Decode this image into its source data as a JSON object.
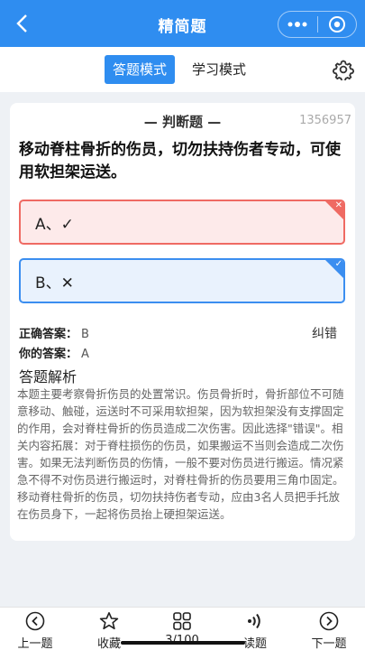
{
  "header": {
    "title": "精简题"
  },
  "modes": {
    "answer_mode": "答题模式",
    "study_mode": "学习模式"
  },
  "question": {
    "type": "判断题",
    "id": "1356957",
    "stem": "移动脊柱骨折的伤员，切勿扶持伤者专动，可使用软担架运送。",
    "options": [
      {
        "label": "A、✓",
        "state": "wrong"
      },
      {
        "label": "B、✕",
        "state": "correct"
      }
    ]
  },
  "answer": {
    "correct_label": "正确答案：",
    "correct_value": "B",
    "mine_label": "你的答案：",
    "mine_value": "A",
    "report": "纠错"
  },
  "analysis": {
    "title": "答题解析",
    "text": "本题主要考察骨折伤员的处置常识。伤员骨折时，骨折部位不可随意移动、触碰，运送时不可采用软担架，因为软担架没有支撑固定的作用，会对脊柱骨折的伤员造成二次伤害。因此选择\"错误\"。相关内容拓展：对于脊柱损伤的伤员，如果搬运不当则会造成二次伤害。如果无法判断伤员的伤情，一般不要对伤员进行搬运。情况紧急不得不对伤员进行搬运时，对脊柱骨折的伤员要用三角巾固定。移动脊柱骨折的伤员，切勿扶持伤者专动，应由3名人员把手托放在伤员身下，一起将伤员抬上硬担架运送。"
  },
  "bottom": {
    "prev": "上一题",
    "fav": "收藏",
    "count": "3/100",
    "read": "读题",
    "next": "下一题"
  },
  "colors": {
    "primary": "#2f8df0",
    "wrong": "#ef6a63",
    "correct": "#3b8ef0"
  },
  "icons": [
    "back-icon",
    "more-icon",
    "target-icon",
    "gear-icon",
    "prev-icon",
    "star-icon",
    "grid-icon",
    "sound-icon",
    "next-icon"
  ]
}
